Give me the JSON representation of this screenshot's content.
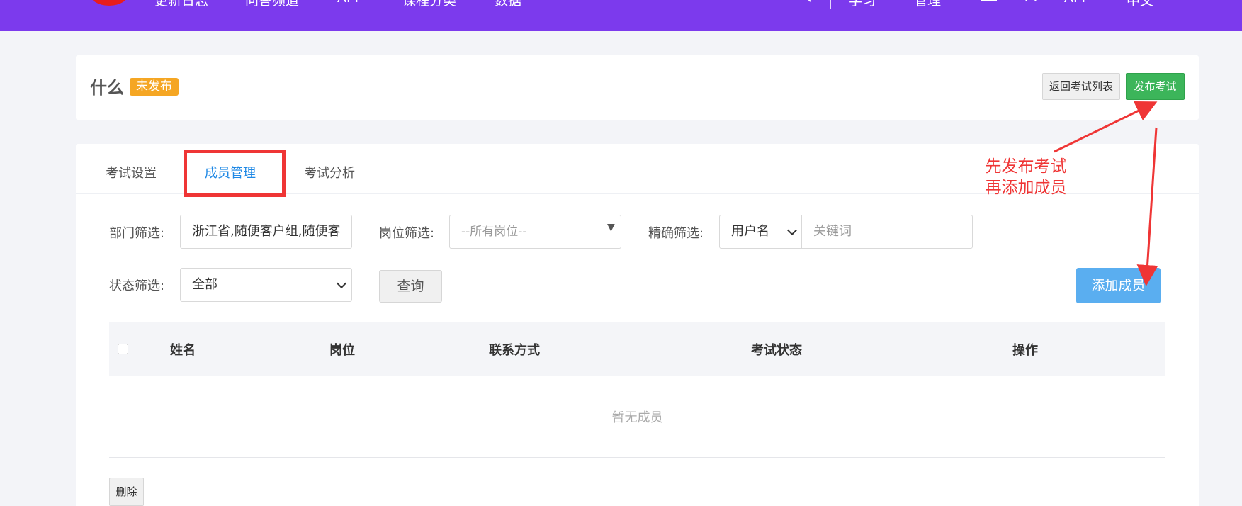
{
  "topbar": {
    "nav": [
      "更新日志",
      "问答频道",
      "API",
      "课程分类",
      "数据"
    ],
    "right": [
      "学习",
      "管理",
      "API",
      "中文"
    ]
  },
  "header": {
    "title": "什么",
    "status": "未发布",
    "back_label": "返回考试列表",
    "publish_label": "发布考试"
  },
  "tabs": [
    {
      "label": "考试设置"
    },
    {
      "label": "成员管理"
    },
    {
      "label": "考试分析"
    }
  ],
  "filters": {
    "department_label": "部门筛选:",
    "department_value": "浙江省,随便客户组,随便客",
    "position_label": "岗位筛选:",
    "position_value": "--所有岗位--",
    "exact_label": "精确筛选:",
    "exact_field": "用户名",
    "keyword_placeholder": "关键词",
    "status_label": "状态筛选:",
    "status_value": "全部",
    "query_label": "查询",
    "add_member_label": "添加成员"
  },
  "table": {
    "headers": [
      "姓名",
      "岗位",
      "联系方式",
      "考试状态",
      "操作"
    ],
    "empty_text": "暂无成员",
    "delete_label": "删除"
  },
  "annotation": {
    "line1": "先发布考试",
    "line2": "再添加成员",
    "color": "#ef3535"
  },
  "colors": {
    "topbar": "#7c3aed",
    "publish": "#3cb55a",
    "badge": "#f5a623",
    "add_member": "#5aaef0",
    "active_tab": "#1e88e5"
  }
}
